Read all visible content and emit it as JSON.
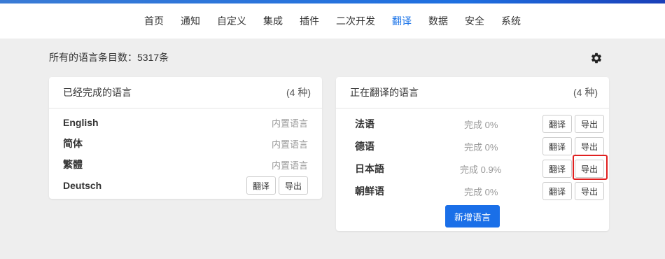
{
  "nav": {
    "items": [
      {
        "label": "首页"
      },
      {
        "label": "通知"
      },
      {
        "label": "自定义"
      },
      {
        "label": "集成"
      },
      {
        "label": "插件"
      },
      {
        "label": "二次开发"
      },
      {
        "label": "翻译"
      },
      {
        "label": "数据"
      },
      {
        "label": "安全"
      },
      {
        "label": "系统"
      }
    ],
    "active": "翻译"
  },
  "summary": "所有的语言条目数：5317条",
  "completed": {
    "title": "已经完成的语言",
    "count": "(4 种)",
    "rows": [
      {
        "lang": "English",
        "tag": "内置语言"
      },
      {
        "lang": "简体",
        "tag": "内置语言"
      },
      {
        "lang": "繁體",
        "tag": "内置语言"
      },
      {
        "lang": "Deutsch",
        "translate": "翻译",
        "export": "导出"
      }
    ]
  },
  "inprogress": {
    "title": "正在翻译的语言",
    "count": "(4 种)",
    "rows": [
      {
        "lang": "法语",
        "progress": "完成 0%",
        "translate": "翻译",
        "export": "导出"
      },
      {
        "lang": "德语",
        "progress": "完成 0%",
        "translate": "翻译",
        "export": "导出"
      },
      {
        "lang": "日本語",
        "progress": "完成 0.9%",
        "translate": "翻译",
        "export": "导出"
      },
      {
        "lang": "朝鲜语",
        "progress": "完成 0%",
        "translate": "翻译",
        "export": "导出"
      }
    ],
    "add_button": "新增语言"
  },
  "colors": {
    "accent": "#1a73e8",
    "primary_button": "#1a6fe8",
    "highlight": "#e02020"
  },
  "icons": {
    "settings": "gear-icon"
  }
}
